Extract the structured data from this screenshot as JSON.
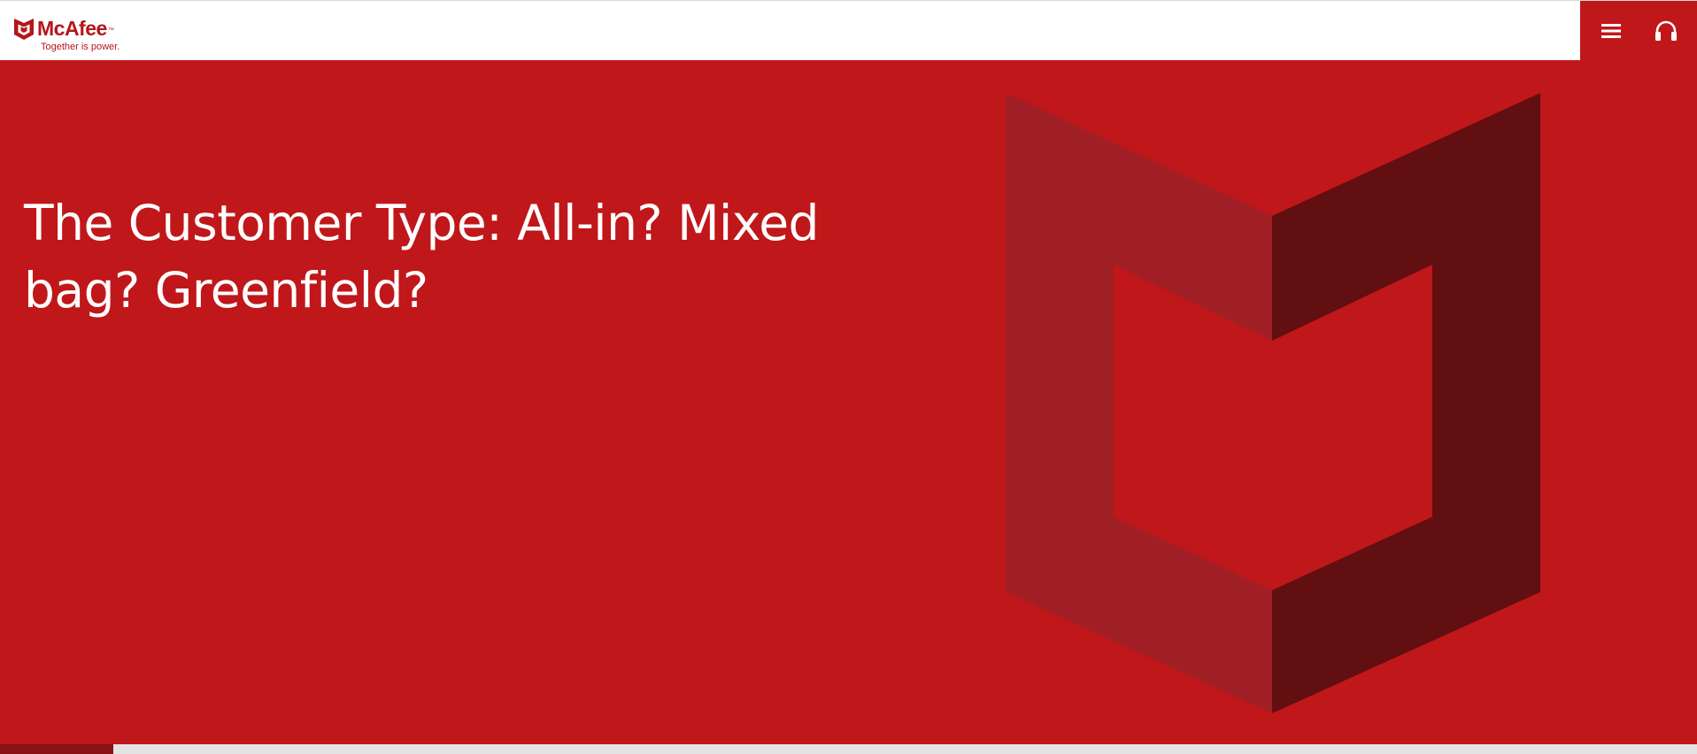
{
  "header": {
    "logo": {
      "wordmark": "McAfee",
      "trademark": "™",
      "tagline": "Together is power."
    },
    "actions": {
      "menu_icon": "hamburger-menu-icon",
      "support_icon": "headphones-icon"
    }
  },
  "hero": {
    "title_line1": "The Customer Type: All-in? Mixed",
    "title_line2": "bag? Greenfield?",
    "graphic_icon": "mcafee-shield-icon"
  },
  "progress": {
    "value_fraction": 0.067
  },
  "colors": {
    "brand_red": "#c0171a",
    "logo_red": "#b5151b",
    "shield_light": "#a01f25",
    "shield_dark": "#610f11",
    "progress_fill": "#8a1114",
    "progress_track": "#e3e3e3"
  }
}
